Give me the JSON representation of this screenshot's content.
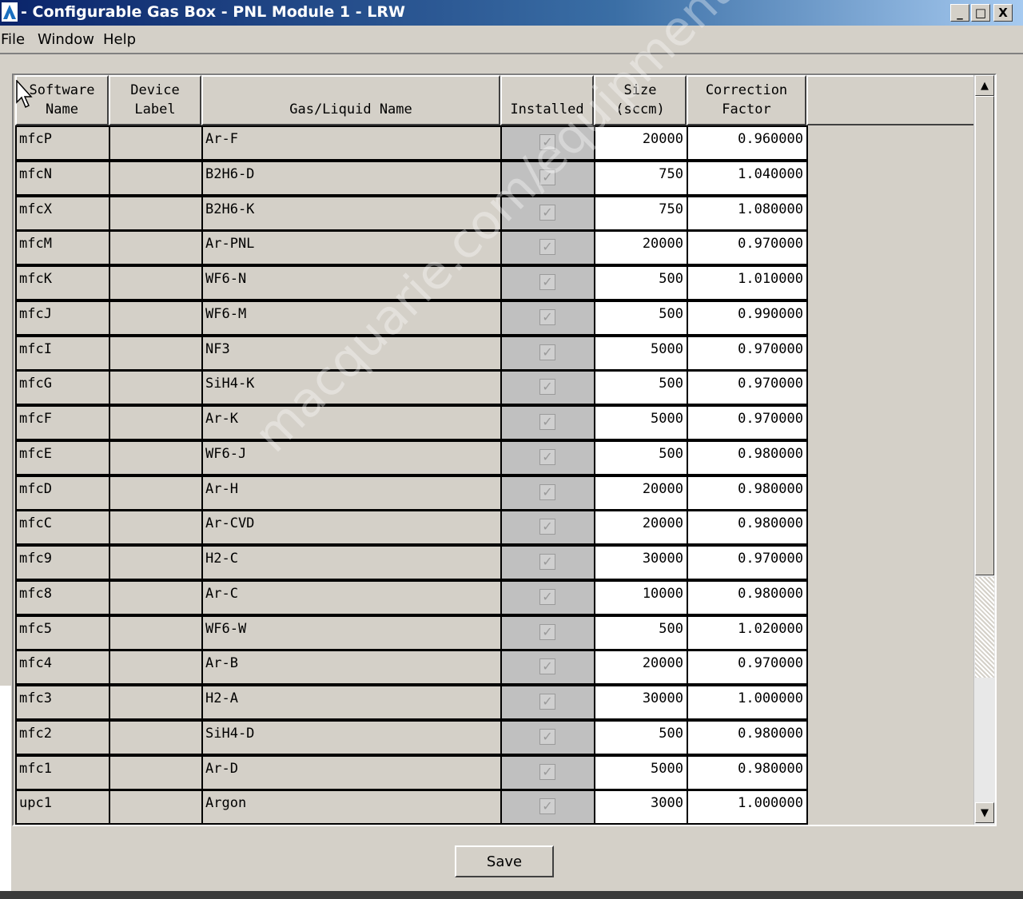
{
  "window": {
    "title": "- Configurable Gas Box - PNL Module 1 - LRW",
    "min": "_",
    "max": "□",
    "close": "X"
  },
  "menu": [
    "File",
    "Window",
    "Help"
  ],
  "table": {
    "headers": [
      "Software\nName",
      "Device\nLabel",
      "Gas/Liquid Name",
      "Installed",
      "Size\n(sccm)",
      "Correction\nFactor"
    ],
    "rows": [
      {
        "software": "mfcP",
        "label": "",
        "gas": "Ar-F",
        "installed": true,
        "size": "20000",
        "factor": "0.960000"
      },
      {
        "software": "mfcN",
        "label": "",
        "gas": "B2H6-D",
        "installed": true,
        "size": "750",
        "factor": "1.040000"
      },
      {
        "software": "mfcX",
        "label": "",
        "gas": "B2H6-K",
        "installed": true,
        "size": "750",
        "factor": "1.080000"
      },
      {
        "software": "mfcM",
        "label": "",
        "gas": "Ar-PNL",
        "installed": true,
        "size": "20000",
        "factor": "0.970000"
      },
      {
        "software": "mfcK",
        "label": "",
        "gas": "WF6-N",
        "installed": true,
        "size": "500",
        "factor": "1.010000"
      },
      {
        "software": "mfcJ",
        "label": "",
        "gas": "WF6-M",
        "installed": true,
        "size": "500",
        "factor": "0.990000"
      },
      {
        "software": "mfcI",
        "label": "",
        "gas": "NF3",
        "installed": true,
        "size": "5000",
        "factor": "0.970000"
      },
      {
        "software": "mfcG",
        "label": "",
        "gas": "SiH4-K",
        "installed": true,
        "size": "500",
        "factor": "0.970000"
      },
      {
        "software": "mfcF",
        "label": "",
        "gas": "Ar-K",
        "installed": true,
        "size": "5000",
        "factor": "0.970000"
      },
      {
        "software": "mfcE",
        "label": "",
        "gas": "WF6-J",
        "installed": true,
        "size": "500",
        "factor": "0.980000"
      },
      {
        "software": "mfcD",
        "label": "",
        "gas": "Ar-H",
        "installed": true,
        "size": "20000",
        "factor": "0.980000"
      },
      {
        "software": "mfcC",
        "label": "",
        "gas": "Ar-CVD",
        "installed": true,
        "size": "20000",
        "factor": "0.980000"
      },
      {
        "software": "mfc9",
        "label": "",
        "gas": "H2-C",
        "installed": true,
        "size": "30000",
        "factor": "0.970000"
      },
      {
        "software": "mfc8",
        "label": "",
        "gas": "Ar-C",
        "installed": true,
        "size": "10000",
        "factor": "0.980000"
      },
      {
        "software": "mfc5",
        "label": "",
        "gas": "WF6-W",
        "installed": true,
        "size": "500",
        "factor": "1.020000"
      },
      {
        "software": "mfc4",
        "label": "",
        "gas": "Ar-B",
        "installed": true,
        "size": "20000",
        "factor": "0.970000"
      },
      {
        "software": "mfc3",
        "label": "",
        "gas": "H2-A",
        "installed": true,
        "size": "30000",
        "factor": "1.000000"
      },
      {
        "software": "mfc2",
        "label": "",
        "gas": "SiH4-D",
        "installed": true,
        "size": "500",
        "factor": "0.980000"
      },
      {
        "software": "mfc1",
        "label": "",
        "gas": "Ar-D",
        "installed": true,
        "size": "5000",
        "factor": "0.980000"
      },
      {
        "software": "upc1",
        "label": "",
        "gas": "Argon",
        "installed": true,
        "size": "3000",
        "factor": "1.000000"
      }
    ]
  },
  "save_label": "Save",
  "watermark": "macquarie.com/equipment",
  "icons": {
    "app": "app-logo-icon",
    "check": "checkmark-icon",
    "up": "scroll-up-icon",
    "down": "scroll-down-icon",
    "cursor": "mouse-pointer-icon"
  }
}
